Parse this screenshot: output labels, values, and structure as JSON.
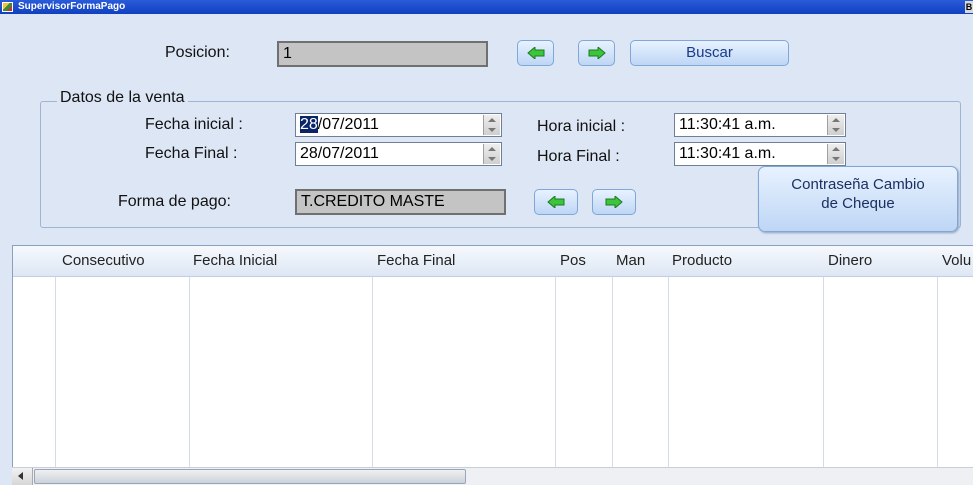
{
  "window": {
    "title": "SupervisorFormaPago",
    "control_glyph": "B"
  },
  "top": {
    "posicion_label": "Posicion:",
    "posicion_value": "1",
    "buscar_label": "Buscar"
  },
  "venta": {
    "group_title": "Datos de la venta",
    "fecha_inicial_label": "Fecha inicial :",
    "fecha_inicial_selected": "28",
    "fecha_inicial_rest": "/07/2011",
    "fecha_final_label": "Fecha Final :",
    "fecha_final_value": "28/07/2011",
    "hora_inicial_label": "Hora inicial :",
    "hora_inicial_value": "11:30:41 a.m.",
    "hora_final_label": "Hora Final :",
    "hora_final_value": "11:30:41 a.m.",
    "forma_pago_label": "Forma de pago:",
    "forma_pago_value": "T.CREDITO MASTE"
  },
  "contrasena_button": {
    "line1": "Contraseña Cambio",
    "line2": "de Cheque"
  },
  "grid": {
    "columns": [
      "Consecutivo",
      "Fecha Inicial",
      "Fecha Final",
      "Pos",
      "Man",
      "Producto",
      "Dinero",
      "Volu"
    ]
  },
  "icons": {
    "left": "green-left-arrow-icon",
    "right": "green-right-arrow-icon"
  },
  "colors": {
    "titlebar": "#1a4fd0",
    "window_bg": "#dde6f4",
    "arrow_green": "#3cc43c",
    "selection": "#0a246a"
  }
}
